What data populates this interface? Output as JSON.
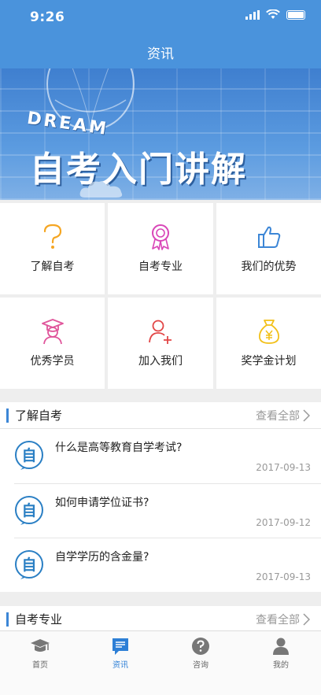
{
  "status": {
    "time": "9:26"
  },
  "nav": {
    "title": "资讯"
  },
  "banner": {
    "dream": "DREAM",
    "title": "自考入门讲解"
  },
  "grid": [
    {
      "label": "了解自考",
      "icon": "question-icon",
      "color": "#f5a623"
    },
    {
      "label": "自考专业",
      "icon": "award-ribbon-icon",
      "color": "#d946b8"
    },
    {
      "label": "我们的优势",
      "icon": "thumbs-up-icon",
      "color": "#3c86d6"
    },
    {
      "label": "优秀学员",
      "icon": "graduate-icon",
      "color": "#e0559b"
    },
    {
      "label": "加入我们",
      "icon": "add-user-icon",
      "color": "#e24545"
    },
    {
      "label": "奖学金计划",
      "icon": "money-bag-icon",
      "color": "#f2c018"
    }
  ],
  "sections": [
    {
      "title": "了解自考",
      "more": "查看全部",
      "items": [
        {
          "title": "什么是高等教育自学考试?",
          "date": "2017-09-13"
        },
        {
          "title": "如何申请学位证书?",
          "date": "2017-09-12"
        },
        {
          "title": "自学学历的含金量?",
          "date": "2017-09-13"
        }
      ]
    },
    {
      "title": "自考专业",
      "more": "查看全部"
    }
  ],
  "news_icon_char": "自",
  "tabs": [
    {
      "label": "首页",
      "icon": "graduation-cap-icon"
    },
    {
      "label": "资讯",
      "icon": "news-icon",
      "active": true
    },
    {
      "label": "咨询",
      "icon": "help-circle-icon"
    },
    {
      "label": "我的",
      "icon": "user-icon"
    }
  ],
  "colors": {
    "accent": "#4a93dc",
    "tab_active": "#2d7fd6"
  }
}
